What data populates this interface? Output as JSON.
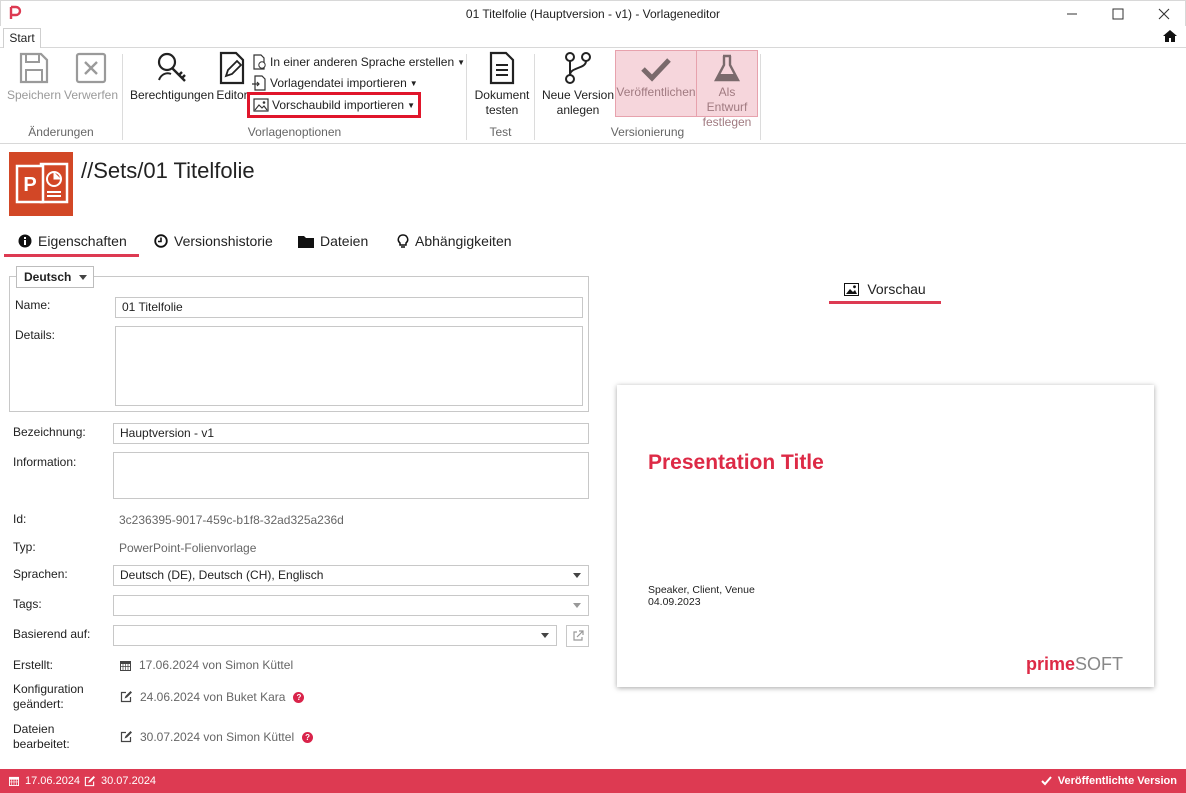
{
  "window": {
    "title": "01 Titelfolie (Hauptversion - v1) - Vorlageneditor",
    "minimize": "—",
    "maximize": "☐",
    "close": "✕"
  },
  "ribbon": {
    "tab_start": "Start",
    "save": "Speichern",
    "discard": "Verwerfen",
    "group_changes": "Änderungen",
    "permissions": "Berechtigungen",
    "editor": "Editor",
    "create_other_language": "In einer anderen Sprache erstellen",
    "import_template_file": "Vorlagendatei importieren",
    "import_preview_image": "Vorschaubild importieren",
    "group_template_options": "Vorlagenoptionen",
    "test_document_line1": "Dokument",
    "test_document_line2": "testen",
    "group_test": "Test",
    "new_version_line1": "Neue Version",
    "new_version_line2": "anlegen",
    "publish": "Veröffentlichen",
    "set_draft_line1": "Als Entwurf",
    "set_draft_line2": "festlegen",
    "group_versioning": "Versionierung"
  },
  "header": {
    "path": "//Sets/01 Titelfolie",
    "icon_letter": "P"
  },
  "tabs": [
    {
      "label": "Eigenschaften"
    },
    {
      "label": "Versionshistorie"
    },
    {
      "label": "Dateien"
    },
    {
      "label": "Abhängigkeiten"
    }
  ],
  "form": {
    "language": "Deutsch",
    "name_label": "Name:",
    "name_value": "01 Titelfolie",
    "details_label": "Details:",
    "designation_label": "Bezeichnung:",
    "designation_value": "Hauptversion - v1",
    "information_label": "Information:",
    "id_label": "Id:",
    "id_value": "3c236395-9017-459c-b1f8-32ad325a236d",
    "type_label": "Typ:",
    "type_value": "PowerPoint-Folienvorlage",
    "languages_label": "Sprachen:",
    "languages_value": "Deutsch (DE), Deutsch (CH), Englisch",
    "tags_label": "Tags:",
    "based_on_label": "Basierend auf:",
    "created_label": "Erstellt:",
    "created_value": "17.06.2024 von Simon Küttel",
    "config_changed_label_1": "Konfiguration",
    "config_changed_label_2": "geändert:",
    "config_changed_value": "24.06.2024 von Buket Kara",
    "files_edited_label_1": "Dateien",
    "files_edited_label_2": "bearbeitet:",
    "files_edited_value": "30.07.2024 von Simon Küttel",
    "help": "?"
  },
  "preview": {
    "tab_label": "Vorschau",
    "slide_title": "Presentation Title",
    "slide_subtitle": "Speaker, Client, Venue",
    "slide_date": "04.09.2023",
    "logo_part1": "prime",
    "logo_part2": "SOFT"
  },
  "statusbar": {
    "created_date": "17.06.2024",
    "edited_date": "30.07.2024",
    "status": "Veröffentlichte Version"
  },
  "colors": {
    "accent": "#dd3a52",
    "highlight": "#e0162b",
    "ppt": "#d24726"
  }
}
